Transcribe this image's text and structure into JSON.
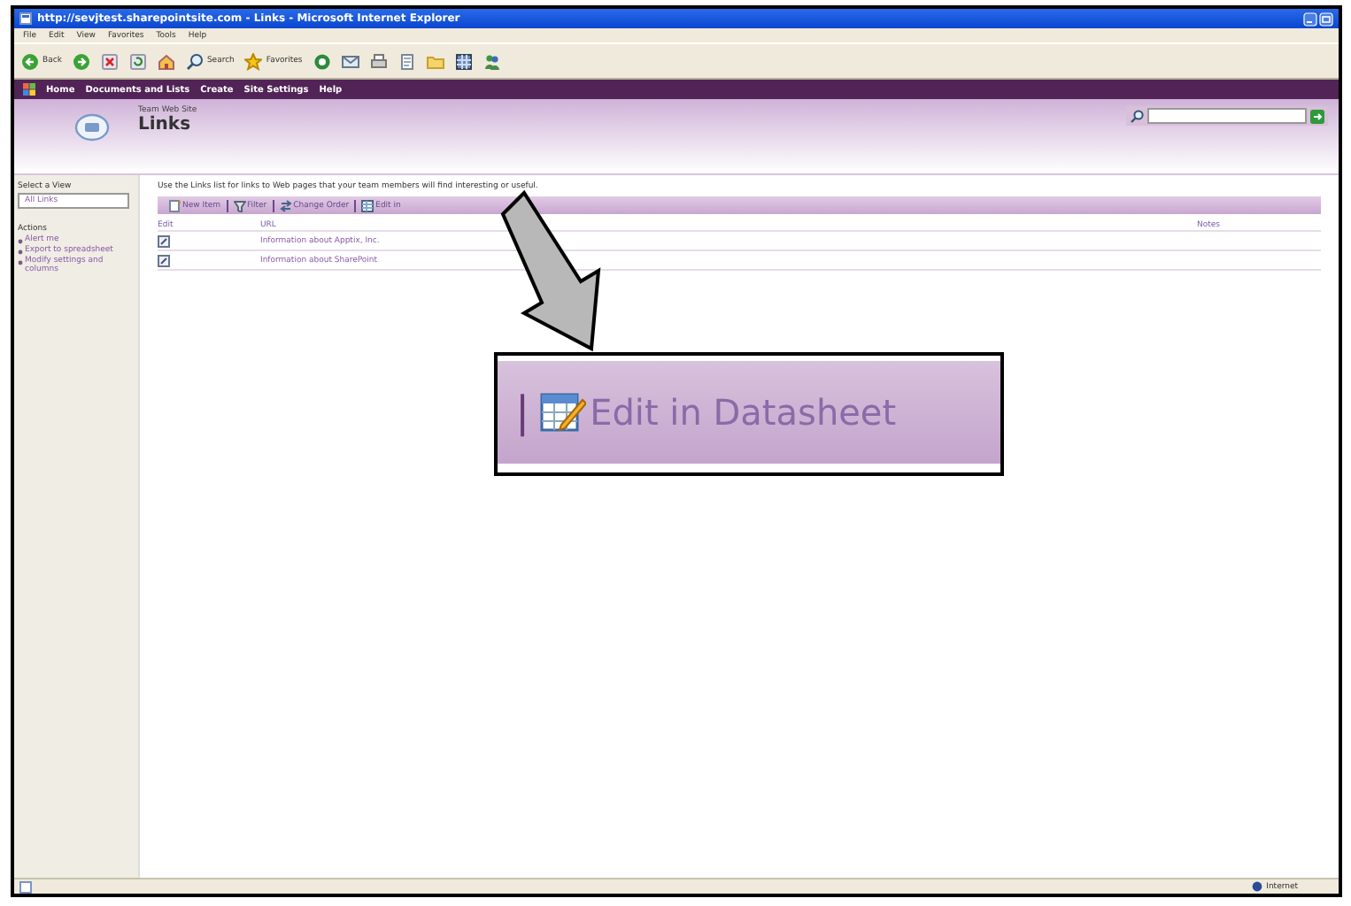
{
  "window": {
    "title": "http://sevjtest.sharepointsite.com - Links - Microsoft Internet Explorer"
  },
  "menu_bar": [
    "File",
    "Edit",
    "View",
    "Favorites",
    "Tools",
    "Help"
  ],
  "browser_toolbar": [
    {
      "kind": "back",
      "label": "Back"
    },
    {
      "kind": "forward"
    },
    {
      "kind": "stop"
    },
    {
      "kind": "refresh"
    },
    {
      "kind": "home"
    },
    {
      "kind": "search",
      "label": "Search"
    },
    {
      "kind": "favorites",
      "label": "Favorites"
    },
    {
      "kind": "media"
    },
    {
      "kind": "mail"
    },
    {
      "kind": "print"
    },
    {
      "kind": "edit"
    },
    {
      "kind": "folder"
    },
    {
      "kind": "chart"
    },
    {
      "kind": "messenger"
    }
  ],
  "site_nav": [
    "Home",
    "Documents and Lists",
    "Create",
    "Site Settings",
    "Help"
  ],
  "header": {
    "site": "Team Web Site",
    "title": "Links"
  },
  "sidebar": {
    "view_heading": "Select a View",
    "view": "All Links",
    "actions_heading": "Actions",
    "actions": [
      "Alert me",
      "Export to spreadsheet",
      "Modify settings and columns"
    ]
  },
  "description": "Use the Links list for links to Web pages that your team members will find interesting or useful.",
  "list_toolbar": [
    {
      "kind": "new",
      "label": "New Item"
    },
    {
      "kind": "filter",
      "label": "Filter"
    },
    {
      "kind": "order",
      "label": "Change Order"
    },
    {
      "kind": "datasheet",
      "label": "Edit in"
    }
  ],
  "table": {
    "columns": [
      "Edit",
      "URL",
      "Notes"
    ],
    "rows": [
      {
        "url": "Information about Apptix, Inc."
      },
      {
        "url": "Information about SharePoint"
      }
    ]
  },
  "status_bar": {
    "zone": "Internet"
  },
  "callout": {
    "separator": "|",
    "label": "Edit in Datasheet"
  }
}
